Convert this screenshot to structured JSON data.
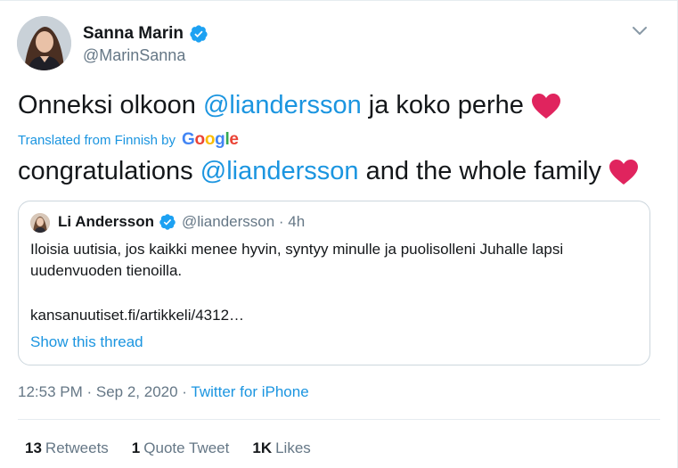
{
  "tweet": {
    "author_name": "Sanna Marin",
    "author_handle": "@MarinSanna",
    "text_before": "Onneksi olkoon ",
    "text_mention": "@liandersson",
    "text_after": " ja koko perhe",
    "translated_label": "Translated from Finnish by",
    "translator_brand": [
      "G",
      "o",
      "o",
      "g",
      "l",
      "e"
    ],
    "translation_before": "congratulations ",
    "translation_mention": "@liandersson",
    "translation_after": " and the whole family",
    "timestamp": "12:53 PM · Sep 2, 2020",
    "separator": " · ",
    "source": "Twitter for iPhone"
  },
  "quoted_tweet": {
    "author_name": "Li Andersson",
    "author_handle": "@liandersson · 4h",
    "body": "Iloisia uutisia, jos kaikki menee hyvin, syntyy minulle ja puolisolleni Juhalle lapsi uudenvuoden tienoilla.",
    "link": "kansanuutiset.fi/artikkeli/4312…",
    "show_thread": "Show this thread"
  },
  "stats": {
    "retweets_count": "13",
    "retweets_label": "Retweets",
    "quotes_count": "1",
    "quotes_label": "Quote Tweet",
    "likes_count": "1K",
    "likes_label": "Likes"
  },
  "colors": {
    "link_blue": "#1b95e0",
    "heart_red": "#e0245e",
    "verified_blue": "#1da1f2",
    "muted_gray": "#657786"
  },
  "icons": [
    "verified-badge-icon",
    "chevron-down-icon",
    "red-heart-icon"
  ]
}
